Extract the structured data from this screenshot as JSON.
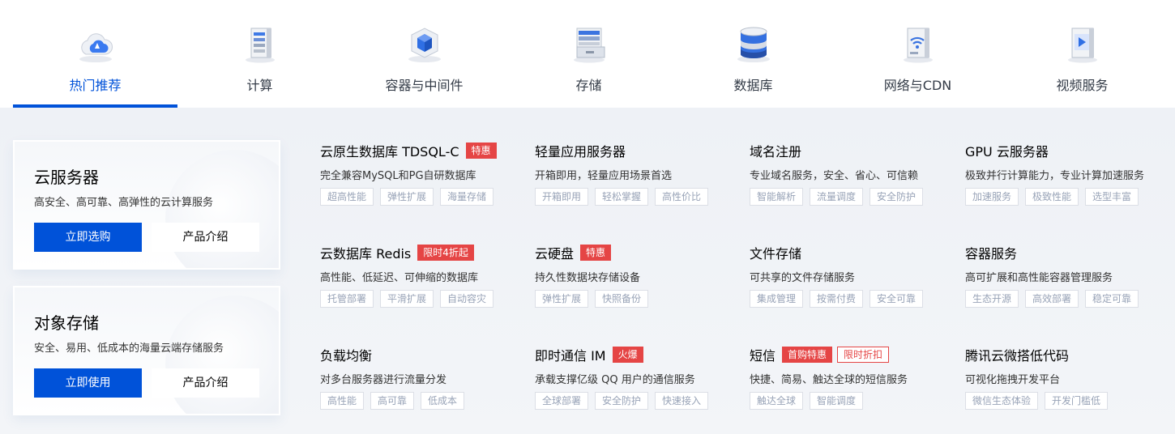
{
  "tabs": [
    {
      "label": "热门推荐",
      "icon": "cloud-icon",
      "active": true
    },
    {
      "label": "计算",
      "icon": "server-icon"
    },
    {
      "label": "容器与中间件",
      "icon": "container-box-icon"
    },
    {
      "label": "存储",
      "icon": "storage-drawer-icon"
    },
    {
      "label": "数据库",
      "icon": "database-icon"
    },
    {
      "label": "网络与CDN",
      "icon": "network-wifi-icon"
    },
    {
      "label": "视频服务",
      "icon": "video-play-icon"
    }
  ],
  "cards": [
    {
      "title": "云服务器",
      "desc": "高安全、高可靠、高弹性的云计算服务",
      "primary": "立即选购",
      "secondary": "产品介绍"
    },
    {
      "title": "对象存储",
      "desc": "安全、易用、低成本的海量云端存储服务",
      "primary": "立即使用",
      "secondary": "产品介绍"
    }
  ],
  "products": [
    {
      "name": "云原生数据库 TDSQL-C",
      "badges": [
        "特惠"
      ],
      "desc": "完全兼容MySQL和PG自研数据库",
      "tags": [
        "超高性能",
        "弹性扩展",
        "海量存储"
      ]
    },
    {
      "name": "轻量应用服务器",
      "badges": [],
      "desc": "开箱即用，轻量应用场景首选",
      "tags": [
        "开箱即用",
        "轻松掌握",
        "高性价比"
      ]
    },
    {
      "name": "域名注册",
      "badges": [],
      "desc": "专业域名服务，安全、省心、可信赖",
      "tags": [
        "智能解析",
        "流量调度",
        "安全防护"
      ]
    },
    {
      "name": "GPU 云服务器",
      "badges": [],
      "desc": "极致并行计算能力，专业计算加速服务",
      "tags": [
        "加速服务",
        "极致性能",
        "选型丰富"
      ]
    },
    {
      "name": "云数据库 Redis",
      "badges": [
        "限时4折起"
      ],
      "desc": "高性能、低延迟、可伸缩的数据库",
      "tags": [
        "托管部署",
        "平滑扩展",
        "自动容灾"
      ]
    },
    {
      "name": "云硬盘",
      "badges": [
        "特惠"
      ],
      "desc": "持久性数据块存储设备",
      "tags": [
        "弹性扩展",
        "快照备份"
      ]
    },
    {
      "name": "文件存储",
      "badges": [],
      "desc": "可共享的文件存储服务",
      "tags": [
        "集成管理",
        "按需付费",
        "安全可靠"
      ]
    },
    {
      "name": "容器服务",
      "badges": [],
      "desc": "高可扩展和高性能容器管理服务",
      "tags": [
        "生态开源",
        "高效部署",
        "稳定可靠"
      ]
    },
    {
      "name": "负载均衡",
      "badges": [],
      "desc": "对多台服务器进行流量分发",
      "tags": [
        "高性能",
        "高可靠",
        "低成本"
      ]
    },
    {
      "name": "即时通信 IM",
      "badges": [
        "火爆"
      ],
      "desc": "承载支撑亿级 QQ 用户的通信服务",
      "tags": [
        "全球部署",
        "安全防护",
        "快速接入"
      ]
    },
    {
      "name": "短信",
      "badges": [
        "首购特惠",
        "限时折扣"
      ],
      "desc": "快捷、简易、触达全球的短信服务",
      "tags": [
        "触达全球",
        "智能调度"
      ]
    },
    {
      "name": "腾讯云微搭低代码",
      "badges": [],
      "desc": "可视化拖拽开发平台",
      "tags": [
        "微信生态体验",
        "开发门槛低"
      ]
    }
  ],
  "colors": {
    "accent": "#0052d9",
    "badge": "#e54545",
    "panel_bg": "#eef1f6"
  }
}
